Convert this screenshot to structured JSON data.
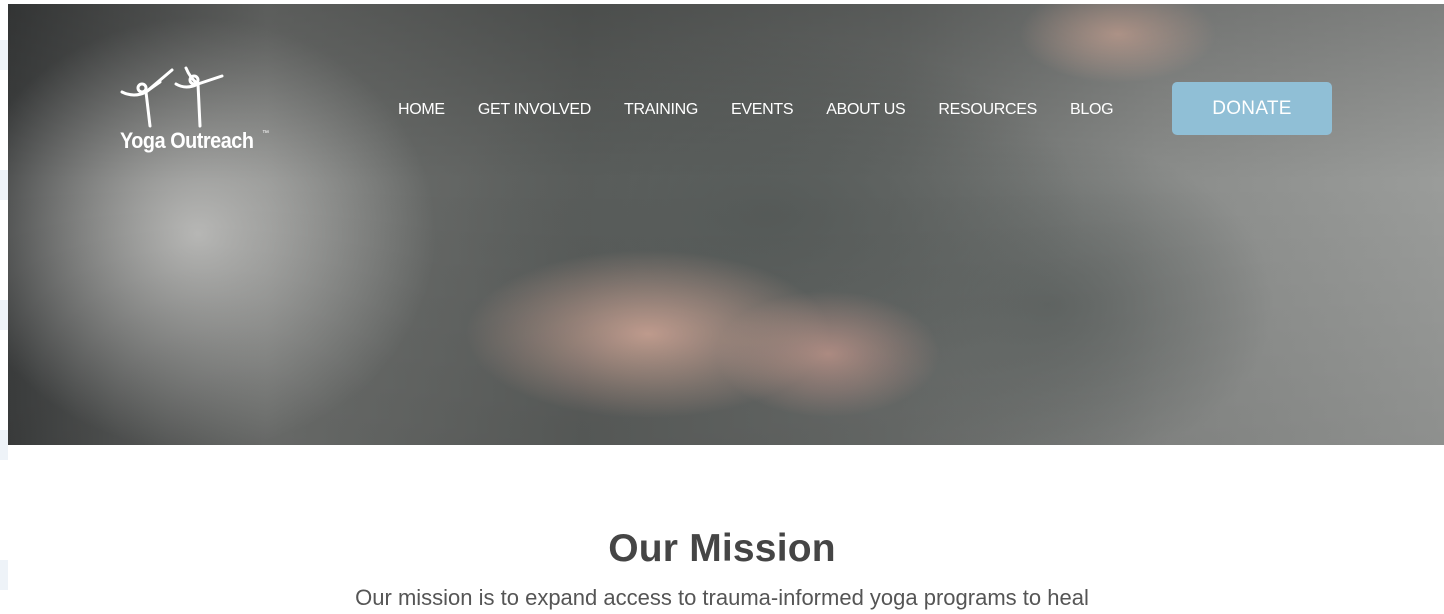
{
  "brand": {
    "name": "Yoga Outreach",
    "trademark": "™"
  },
  "nav": {
    "items": [
      {
        "label": "HOME"
      },
      {
        "label": "GET INVOLVED"
      },
      {
        "label": "TRAINING"
      },
      {
        "label": "EVENTS"
      },
      {
        "label": "ABOUT US"
      },
      {
        "label": "RESOURCES"
      },
      {
        "label": "BLOG"
      }
    ],
    "donate_label": "DONATE"
  },
  "mission": {
    "title": "Our Mission",
    "text": "Our mission is to expand access to trauma-informed yoga programs to heal"
  },
  "colors": {
    "donate_bg": "#90bfd6",
    "heading": "#454545",
    "body_text": "#555555"
  }
}
